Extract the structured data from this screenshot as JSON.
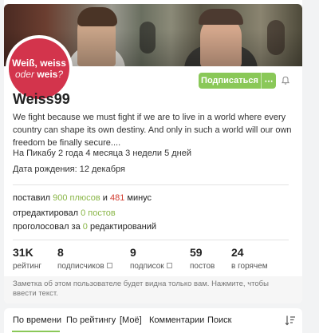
{
  "profile": {
    "avatar": {
      "line1": "Weiß, weiss",
      "line2_a": "oder",
      "line2_b": "weis",
      "line2_c": "?",
      "color": "#d3344c"
    },
    "subscribe_label": "Подписаться",
    "subscribe_more": "⋯",
    "nickname": "Weiss99",
    "bio": "We fight because we must fight if we are to live in a world where every country can shape its own destiny. And only in such a world will our own freedom be finally secure....",
    "since": "На Пикабу 2 года 4 месяца 3 недели 5 дней",
    "birthday": "Дата рождения: 12 декабря"
  },
  "activity": {
    "line1_a": "поставил ",
    "line1_plus": "900 плюсов",
    "line1_b": " и ",
    "line1_minus": "481",
    "line1_c": " минус",
    "line2_a": "отредактировал ",
    "line2_b": "0 постов",
    "line3_a": "проголосовал за ",
    "line3_b": "0",
    "line3_c": " редактирований"
  },
  "counters": [
    {
      "num": "31K",
      "cap": "рейтинг"
    },
    {
      "num": "8",
      "cap": "подписчиков"
    },
    {
      "num": "9",
      "cap": "подписок"
    },
    {
      "num": "59",
      "cap": "постов"
    },
    {
      "num": "24",
      "cap": "в горячем"
    }
  ],
  "note": "Заметка об этом пользователе будет видна только вам. Нажмите, чтобы ввести текст.",
  "tabs": [
    {
      "label": "По времени"
    },
    {
      "label": "По рейтингу"
    },
    {
      "label": "[Моё]"
    },
    {
      "label": "Комментарии"
    },
    {
      "label": "Поиск"
    }
  ],
  "colors": {
    "accent_green": "#8ac858",
    "plus_green": "#8ab648",
    "minus_red": "#d23d31"
  },
  "icons": [
    "bell-icon",
    "more-icon",
    "external-link-icon",
    "sort-icon"
  ]
}
